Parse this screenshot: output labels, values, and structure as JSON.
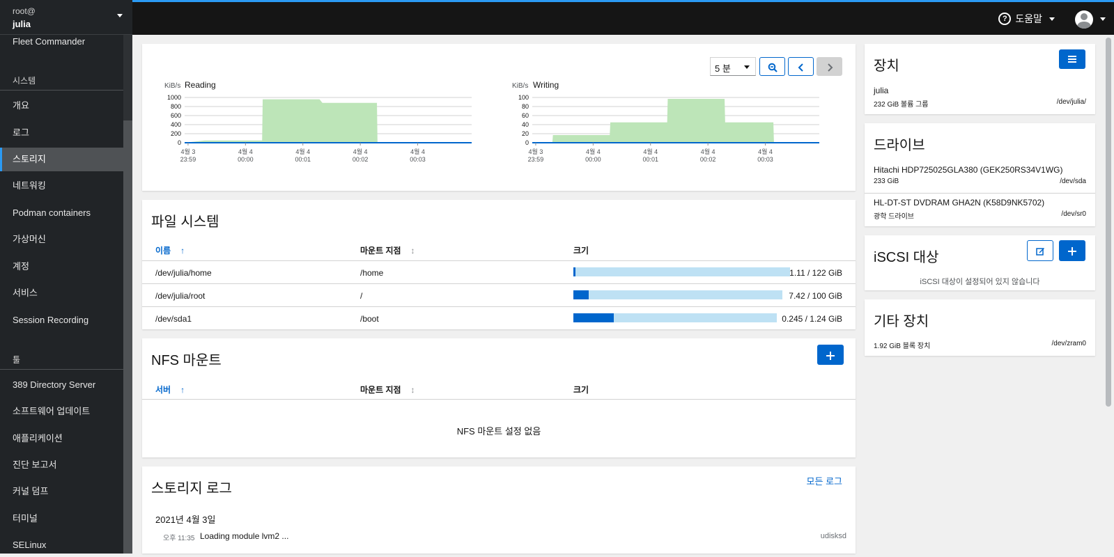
{
  "sidebar": {
    "user": "root@",
    "host": "julia",
    "items_top": [
      {
        "label": "Fleet Commander"
      }
    ],
    "section_system": "시스템",
    "system_items": [
      {
        "label": "개요"
      },
      {
        "label": "로그"
      },
      {
        "label": "스토리지"
      },
      {
        "label": "네트워킹"
      },
      {
        "label": "Podman containers"
      },
      {
        "label": "가상머신"
      },
      {
        "label": "계정"
      },
      {
        "label": "서비스"
      },
      {
        "label": "Session Recording"
      }
    ],
    "active_item": "스토리지",
    "section_tools": "툴",
    "tools_items": [
      {
        "label": "389 Directory Server"
      },
      {
        "label": "소프트웨어 업데이트"
      },
      {
        "label": "애플리케이션"
      },
      {
        "label": "진단 보고서"
      },
      {
        "label": "커널 덤프"
      },
      {
        "label": "터미널"
      },
      {
        "label": "SELinux"
      }
    ]
  },
  "topbar": {
    "help_label": "도움말",
    "help_icon": "question-circle-icon",
    "avatar_icon": "user-avatar-icon"
  },
  "graphs": {
    "range_select": "5 분",
    "zoom_icon": "zoom-out-icon",
    "prev_icon": "chevron-left-icon",
    "next_icon": "chevron-right-icon"
  },
  "chart_data": [
    {
      "type": "area",
      "title": "Reading",
      "ylabel": "KiB/s",
      "yticks": [
        "1000",
        "800",
        "600",
        "400",
        "200",
        "0"
      ],
      "ylim": [
        0,
        1000
      ],
      "xticks": [
        [
          "4월 3",
          "23:59"
        ],
        [
          "4월 4",
          "00:00"
        ],
        [
          "4월 4",
          "00:01"
        ],
        [
          "4월 4",
          "00:02"
        ],
        [
          "4월 4",
          "00:03"
        ]
      ],
      "x_minutes": [
        0,
        0.35,
        1.35,
        1.36,
        2.35,
        2.4,
        3.35,
        3.36,
        4.8
      ],
      "values": [
        0,
        50,
        50,
        960,
        960,
        880,
        880,
        0,
        0
      ],
      "color": "#bde5b8",
      "line_color": "#3e8635"
    },
    {
      "type": "area",
      "title": "Writing",
      "ylabel": "KiB/s",
      "yticks": [
        "100",
        "80",
        "60",
        "40",
        "20",
        "0"
      ],
      "ylim": [
        0,
        100
      ],
      "xticks": [
        [
          "4월 3",
          "23:59"
        ],
        [
          "4월 4",
          "00:00"
        ],
        [
          "4월 4",
          "00:01"
        ],
        [
          "4월 4",
          "00:02"
        ],
        [
          "4월 4",
          "00:03"
        ]
      ],
      "x_minutes": [
        0,
        0.35,
        0.36,
        1.35,
        1.36,
        2.35,
        2.36,
        3.35,
        3.36,
        4.2,
        4.21,
        4.8
      ],
      "values": [
        0,
        0,
        17,
        17,
        45,
        45,
        97,
        97,
        45,
        45,
        0,
        0
      ],
      "color": "#bde5b8",
      "line_color": "#3e8635"
    }
  ],
  "filesystems": {
    "title": "파일 시스템",
    "headers": [
      "이름",
      "마운트 지점",
      "크기"
    ],
    "rows": [
      {
        "name": "/dev/julia/home",
        "mount": "/home",
        "size": "1.11 / 122 GiB",
        "fraction": 0.009
      },
      {
        "name": "/dev/julia/root",
        "mount": "/",
        "size": "7.42 / 100 GiB",
        "fraction": 0.074
      },
      {
        "name": "/dev/sda1",
        "mount": "/boot",
        "size": "0.245 / 1.24 GiB",
        "fraction": 0.198
      }
    ]
  },
  "nfs": {
    "title": "NFS 마운트",
    "headers": [
      "서버",
      "마운트 지점",
      "크기"
    ],
    "empty": "NFS 마운트 설정 없음",
    "add_icon": "plus-icon"
  },
  "storage_log": {
    "title": "스토리지 로그",
    "all_logs": "모든 로그",
    "date": "2021년 4월 3일",
    "entries": [
      {
        "time": "오후 11:35",
        "message": "Loading module lvm2 ...",
        "source": "udisksd"
      }
    ]
  },
  "devices": {
    "title": "장치",
    "menu_icon": "menu-icon",
    "items": [
      {
        "name": "julia",
        "sub": "232 GiB 볼륨 그룹",
        "path": "/dev/julia/"
      }
    ]
  },
  "drives": {
    "title": "드라이브",
    "items": [
      {
        "name": "Hitachi HDP725025GLA380 (GEK250RS34V1WG)",
        "sub": "233 GiB",
        "path": "/dev/sda"
      },
      {
        "name": "HL-DT-ST DVDRAM GHA2N (K58D9NK5702)",
        "sub": "광학 드라이브",
        "path": "/dev/sr0"
      }
    ]
  },
  "iscsi": {
    "title": "iSCSI 대상",
    "empty": "iSCSI 대상이 설정되어 있지 않습니다",
    "edit_icon": "edit-icon",
    "add_icon": "plus-icon"
  },
  "other_devices": {
    "title": "기타 장치",
    "items": [
      {
        "sub": "1.92 GiB 블록 장치",
        "path": "/dev/zram0"
      }
    ]
  }
}
